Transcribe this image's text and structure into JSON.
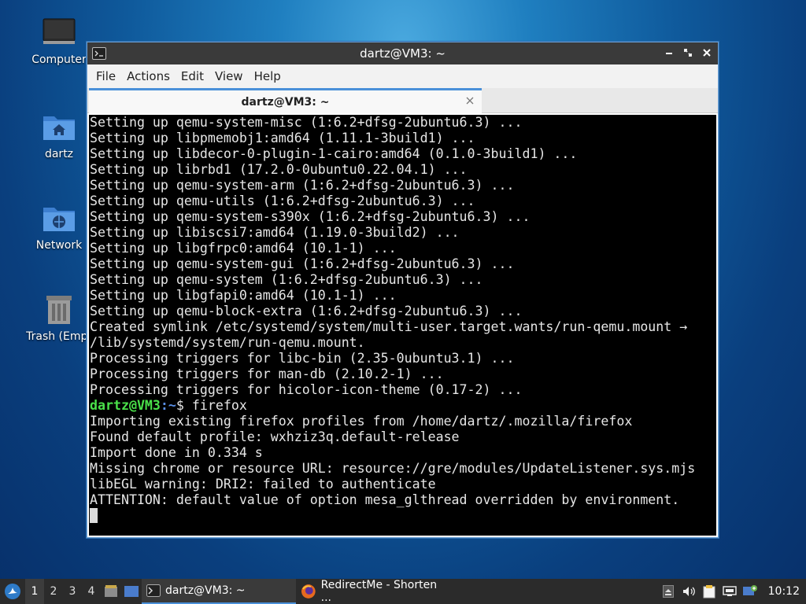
{
  "desktop": {
    "icons": [
      {
        "label": "Computer"
      },
      {
        "label": "dartz"
      },
      {
        "label": "Network"
      },
      {
        "label": "Trash (Empt"
      }
    ]
  },
  "window": {
    "title": "dartz@VM3: ~",
    "menu": [
      "File",
      "Actions",
      "Edit",
      "View",
      "Help"
    ],
    "tab": {
      "label": "dartz@VM3: ~"
    }
  },
  "terminal": {
    "lines": [
      "Setting up qemu-system-misc (1:6.2+dfsg-2ubuntu6.3) ...",
      "Setting up libpmemobj1:amd64 (1.11.1-3build1) ...",
      "Setting up libdecor-0-plugin-1-cairo:amd64 (0.1.0-3build1) ...",
      "Setting up librbd1 (17.2.0-0ubuntu0.22.04.1) ...",
      "Setting up qemu-system-arm (1:6.2+dfsg-2ubuntu6.3) ...",
      "Setting up qemu-utils (1:6.2+dfsg-2ubuntu6.3) ...",
      "Setting up qemu-system-s390x (1:6.2+dfsg-2ubuntu6.3) ...",
      "Setting up libiscsi7:amd64 (1.19.0-3build2) ...",
      "Setting up libgfrpc0:amd64 (10.1-1) ...",
      "Setting up qemu-system-gui (1:6.2+dfsg-2ubuntu6.3) ...",
      "Setting up qemu-system (1:6.2+dfsg-2ubuntu6.3) ...",
      "Setting up libgfapi0:amd64 (10.1-1) ...",
      "Setting up qemu-block-extra (1:6.2+dfsg-2ubuntu6.3) ...",
      "Created symlink /etc/systemd/system/multi-user.target.wants/run-qemu.mount →",
      "/lib/systemd/system/run-qemu.mount.",
      "Processing triggers for libc-bin (2.35-0ubuntu3.1) ...",
      "Processing triggers for man-db (2.10.2-1) ...",
      "Processing triggers for hicolor-icon-theme (0.17-2) ..."
    ],
    "prompt": {
      "user_host": "dartz@VM3",
      "path": ":~",
      "symbol": "$ ",
      "command": "firefox"
    },
    "output": [
      "Importing existing firefox profiles from /home/dartz/.mozilla/firefox",
      "Found default profile: wxhziz3q.default-release",
      "Import done in 0.334 s",
      "Missing chrome or resource URL: resource://gre/modules/UpdateListener.sys.mjs",
      "libEGL warning: DRI2: failed to authenticate",
      "ATTENTION: default value of option mesa_glthread overridden by environment."
    ]
  },
  "taskbar": {
    "workspaces": [
      "1",
      "2",
      "3",
      "4"
    ],
    "tasks": [
      {
        "label": "dartz@VM3: ~"
      },
      {
        "label": "RedirectMe - Shorten ..."
      }
    ],
    "clock": "10:12"
  },
  "colors": {
    "prompt_user": "#4ae04a",
    "prompt_path": "#5a8fe6",
    "tab_accent": "#4a90d9"
  }
}
